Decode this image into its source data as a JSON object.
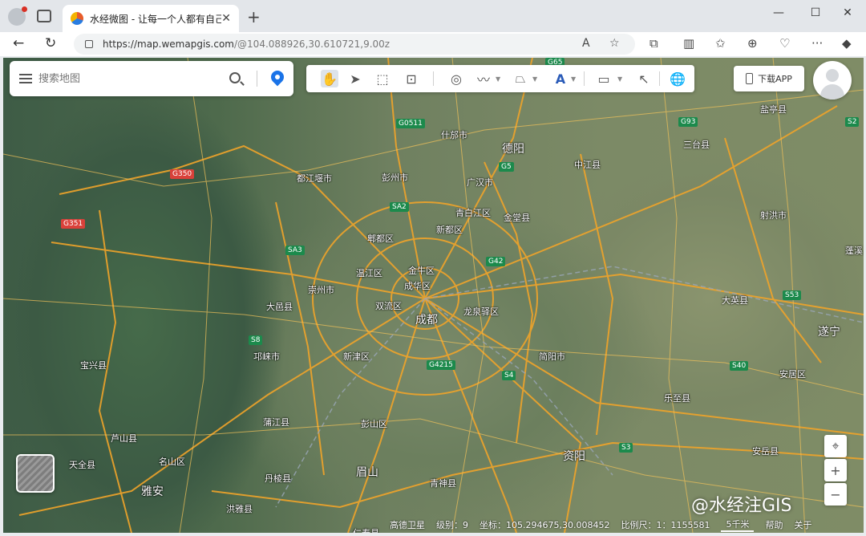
{
  "browser": {
    "tab_title": "水经微图 - 让每一个人都有自己的",
    "url_host": "https://map.wemapgis.com",
    "url_path": "/@104.088926,30.610721,9.00z"
  },
  "map_ui": {
    "search_placeholder": "搜索地图",
    "download_app": "下载APP"
  },
  "status": {
    "map_type": "高德卫星",
    "level_label": "级别：",
    "level": "9",
    "coord_label": "坐标：",
    "coord": "105.294675,30.008452",
    "scale_label": "比例尺：",
    "scale": "1：1155581",
    "scale_bar": "5千米",
    "help": "帮助",
    "about": "关于"
  },
  "watermark": "@水经注GIS",
  "places": [
    {
      "name": "什邡市"
    },
    {
      "name": "德阳"
    },
    {
      "name": "三台县"
    },
    {
      "name": "盐亭县"
    },
    {
      "name": "都江堰市"
    },
    {
      "name": "彭州市"
    },
    {
      "name": "广汉市"
    },
    {
      "name": "中江县"
    },
    {
      "name": "青白江区"
    },
    {
      "name": "金堂县"
    },
    {
      "name": "新都区"
    },
    {
      "name": "射洪市"
    },
    {
      "name": "郫都区"
    },
    {
      "name": "金牛区"
    },
    {
      "name": "温江区"
    },
    {
      "name": "成华区"
    },
    {
      "name": "崇州市"
    },
    {
      "name": "大邑县"
    },
    {
      "name": "双流区"
    },
    {
      "name": "龙泉驿区"
    },
    {
      "name": "大英县"
    },
    {
      "name": "成都"
    },
    {
      "name": "遂宁"
    },
    {
      "name": "邛崃市"
    },
    {
      "name": "新津区"
    },
    {
      "name": "简阳市"
    },
    {
      "name": "宝兴县"
    },
    {
      "name": "安居区"
    },
    {
      "name": "乐至县"
    },
    {
      "name": "蒲江县"
    },
    {
      "name": "彭山区"
    },
    {
      "name": "芦山县"
    },
    {
      "name": "资阳"
    },
    {
      "name": "名山区"
    },
    {
      "name": "天全县"
    },
    {
      "name": "眉山"
    },
    {
      "name": "雅安"
    },
    {
      "name": "丹棱县"
    },
    {
      "name": "青神县"
    },
    {
      "name": "安岳县"
    },
    {
      "name": "洪雅县"
    },
    {
      "name": "仁寿县"
    },
    {
      "name": "蓬溪"
    }
  ],
  "road_shields": [
    {
      "code": "G0511",
      "color": "green"
    },
    {
      "code": "G5",
      "color": "green"
    },
    {
      "code": "G93",
      "color": "green"
    },
    {
      "code": "S2",
      "color": "green"
    },
    {
      "code": "G350",
      "color": "red"
    },
    {
      "code": "G351",
      "color": "red"
    },
    {
      "code": "SA2",
      "color": "green"
    },
    {
      "code": "SA3",
      "color": "green"
    },
    {
      "code": "G42",
      "color": "green"
    },
    {
      "code": "S8",
      "color": "green"
    },
    {
      "code": "G4215",
      "color": "green"
    },
    {
      "code": "S4",
      "color": "green"
    },
    {
      "code": "S40",
      "color": "green"
    },
    {
      "code": "S53",
      "color": "green"
    },
    {
      "code": "S3",
      "color": "green"
    },
    {
      "code": "G65",
      "color": "green"
    }
  ]
}
